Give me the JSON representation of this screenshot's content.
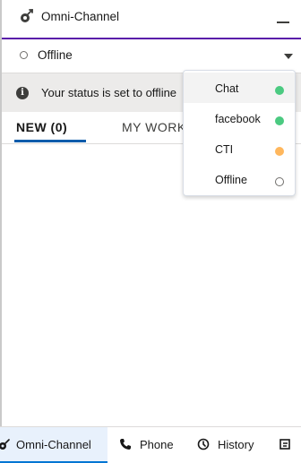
{
  "header": {
    "title": "Omni-Channel",
    "icon": "omni-channel-icon",
    "minimize_icon": "minimize-icon"
  },
  "status": {
    "current": "Offline",
    "dropdown_icon": "chevron-down-icon"
  },
  "info": {
    "icon": "info-icon",
    "text": "Your status is set to offline"
  },
  "tabs": [
    {
      "label": "NEW (0)",
      "active": true
    },
    {
      "label": "MY WORK",
      "active": false
    }
  ],
  "status_menu": {
    "items": [
      {
        "label": "Chat",
        "color": "#4bca81",
        "selected": true
      },
      {
        "label": "facebook",
        "color": "#4bca81",
        "selected": false
      },
      {
        "label": "CTI",
        "color": "#ffb75d",
        "selected": false
      },
      {
        "label": "Offline",
        "color": "#ffffff",
        "selected": false
      }
    ]
  },
  "utility_bar": {
    "items": [
      {
        "label": "Omni-Channel",
        "icon": "omni-channel-icon",
        "active": true
      },
      {
        "label": "Phone",
        "icon": "phone-icon",
        "active": false
      },
      {
        "label": "History",
        "icon": "history-icon",
        "active": false
      },
      {
        "label": "",
        "icon": "notes-icon",
        "active": false
      }
    ]
  },
  "colors": {
    "accent": "#5a1ba9",
    "tab_underline": "#0b5cab",
    "available": "#4bca81",
    "busy": "#ffb75d"
  }
}
